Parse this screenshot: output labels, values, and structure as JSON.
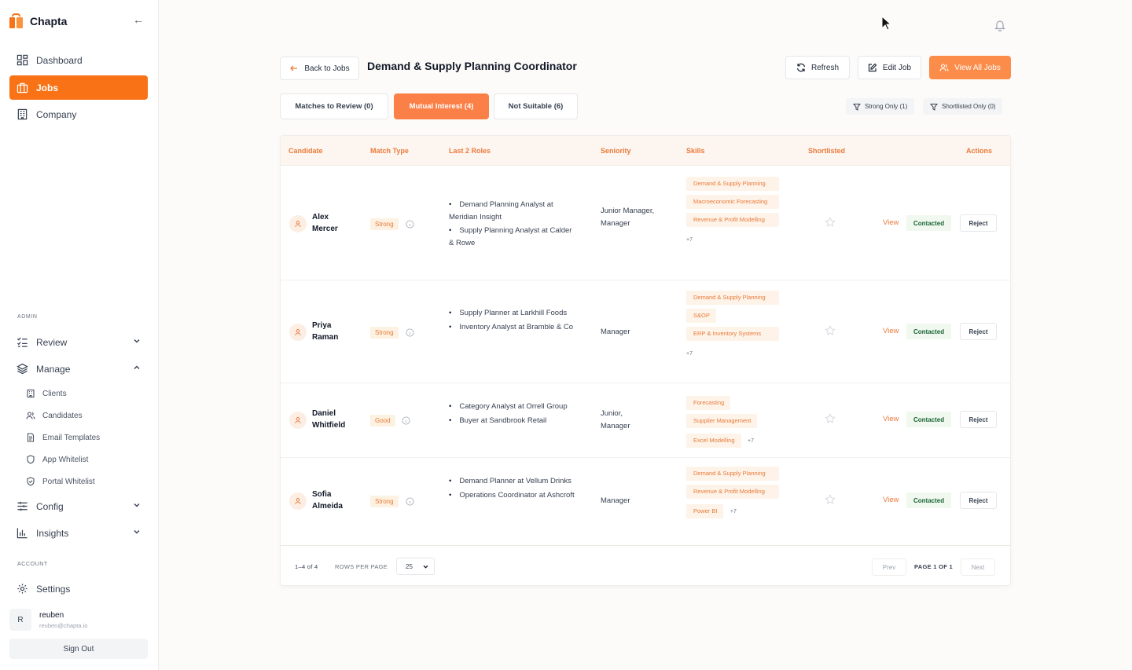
{
  "app": {
    "name": "Chapta"
  },
  "sidebar": {
    "main": [
      {
        "label": "Dashboard",
        "icon": "dashboard-icon"
      },
      {
        "label": "Jobs",
        "icon": "briefcase-icon",
        "active": true
      },
      {
        "label": "Company",
        "icon": "building-icon"
      }
    ],
    "admin_label": "ADMIN",
    "admin": {
      "review": "Review",
      "manage": "Manage",
      "manage_items": [
        "Clients",
        "Candidates",
        "Email Templates",
        "App Whitelist",
        "Portal Whitelist"
      ],
      "config": "Config",
      "insights": "Insights"
    },
    "account_label": "ACCOUNT",
    "settings": "Settings",
    "user": {
      "initial": "R",
      "name": "reuben",
      "email": "reuben@chapta.io"
    },
    "signout": "Sign Out"
  },
  "header": {
    "back_label": "Back to Jobs",
    "title": "Demand & Supply Planning Coordinator",
    "refresh_label": "Refresh",
    "edit_label": "Edit Job",
    "view_all_label": "View All Jobs"
  },
  "tabs": [
    {
      "label": "Matches to Review (0)"
    },
    {
      "label": "Mutual Interest (4)",
      "active": true
    },
    {
      "label": "Not Suitable (6)"
    }
  ],
  "filters": {
    "strong": "Strong Only (1)",
    "shortlisted": "Shortlisted Only (0)"
  },
  "table": {
    "columns": [
      "Candidate",
      "Match Type",
      "Last 2 Roles",
      "Seniority",
      "Skills",
      "Shortlisted",
      "Actions"
    ],
    "rows": [
      {
        "first": "Alex",
        "last": "Mercer",
        "match": "Strong",
        "role1": "Demand Planning Analyst at Meridian Insight",
        "role2": "Supply Planning Analyst at Calder & Rowe",
        "seniority": "Junior Manager, Manager",
        "skills": [
          "Demand & Supply Planning",
          "Macroeconomic Forecasting",
          "Revenue & Profit Modelling"
        ],
        "more": "+7",
        "view": "View",
        "status": "Contacted",
        "reject": "Reject"
      },
      {
        "first": "Priya",
        "last": "Raman",
        "match": "Strong",
        "role1": "Supply Planner at Larkhill Foods",
        "role2": "Inventory Analyst at Bramble & Co",
        "seniority": "Manager",
        "skills": [
          "Demand & Supply Planning",
          "S&OP",
          "ERP & Inventory Systems"
        ],
        "more": "+7",
        "view": "View",
        "status": "Contacted",
        "reject": "Reject"
      },
      {
        "first": "Daniel",
        "last": "Whitfield",
        "match": "Good",
        "role1": "Category Analyst at Orrell Group",
        "role2": "Buyer at Sandbrook Retail",
        "seniority": "Junior, Manager",
        "skills": [
          "Forecasting",
          "Supplier Management",
          "Excel Modelling"
        ],
        "more": "+7",
        "view": "View",
        "status": "Contacted",
        "reject": "Reject"
      },
      {
        "first": "Sofia",
        "last": "Almeida",
        "match": "Strong",
        "role1": "Demand Planner at Vellum Drinks",
        "role2": "Operations Coordinator at Ashcroft",
        "seniority": "Manager",
        "skills": [
          "Demand & Supply Planning",
          "Revenue & Profit Modelling",
          "Power BI"
        ],
        "more": "+7",
        "view": "View",
        "status": "Contacted",
        "reject": "Reject"
      }
    ]
  },
  "pagination": {
    "range": "1–4 of 4",
    "rows_per_page_label": "ROWS PER PAGE",
    "rows_per_page": "25",
    "prev": "Prev",
    "page": "PAGE 1 OF 1",
    "next": "Next"
  }
}
